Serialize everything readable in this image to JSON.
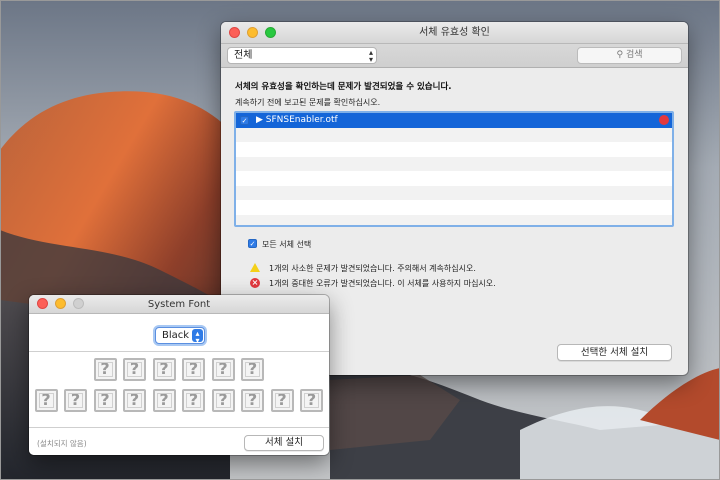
{
  "validation_window": {
    "title": "서체 유효성 확인",
    "filter_selected": "전체",
    "search_placeholder": "검색",
    "heading": "서체의 유효성을 확인하는데 문제가 발견되었을 수 있습니다.",
    "subheading": "계속하기 전에 보고된 문제를 확인하십시오.",
    "fonts": [
      {
        "name": "▶ SFNSEnabler.otf",
        "checked": true,
        "status": "error"
      }
    ],
    "select_all_label": "모든 서체 선택",
    "select_all_checked": true,
    "warning_text": "1개의 사소한 문제가 발견되었습니다. 주의해서 계속하십시오.",
    "error_text": "1개의 중대한 오류가 발견되었습니다. 이 서체를 사용하지 마십시오.",
    "install_selected_label": "선택한 서체 설치"
  },
  "font_window": {
    "title": "System Font",
    "style_selected": "Black",
    "status_text": "(설치되지 않음)",
    "install_label": "서체 설치",
    "preview_rows": [
      [
        "?",
        "?",
        "?",
        "?",
        "?",
        "?"
      ],
      [
        "?",
        "?",
        "?",
        "?",
        "?",
        "?",
        "?",
        "?",
        "?",
        "?"
      ]
    ]
  },
  "colors": {
    "selection": "#1465d8",
    "focus_ring": "#7fb0e8",
    "warning": "#f4d019",
    "error": "#e2383e"
  },
  "icons": {
    "search": "magnifier-icon",
    "warning": "warning-triangle-icon",
    "error": "error-x-icon"
  }
}
